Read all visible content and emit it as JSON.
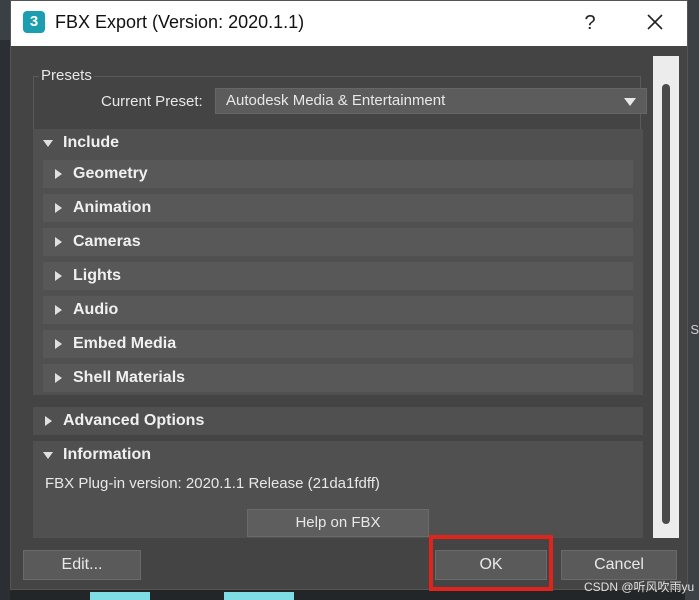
{
  "window": {
    "title": "FBX Export (Version: 2020.1.1)",
    "app_icon_text": "3",
    "help_label": "?"
  },
  "presets": {
    "legend": "Presets",
    "current_label": "Current Preset:",
    "current_value": "Autodesk Media & Entertainment"
  },
  "include": {
    "label": "Include",
    "items": [
      {
        "label": "Geometry"
      },
      {
        "label": "Animation"
      },
      {
        "label": "Cameras"
      },
      {
        "label": "Lights"
      },
      {
        "label": "Audio"
      },
      {
        "label": "Embed Media"
      },
      {
        "label": "Shell Materials"
      }
    ]
  },
  "advanced": {
    "label": "Advanced Options"
  },
  "information": {
    "label": "Information",
    "version_text": "FBX Plug-in version: 2020.1.1 Release (21da1fdff)",
    "help_button": "Help on FBX"
  },
  "buttons": {
    "edit": "Edit...",
    "ok": "OK",
    "cancel": "Cancel"
  },
  "background": {
    "right_label": "S"
  },
  "watermark": "CSDN @听风吹雨yu",
  "colors": {
    "highlight": "#e0241b",
    "dialog_bg": "#444444",
    "accent_cyan": "#7fdde6"
  }
}
